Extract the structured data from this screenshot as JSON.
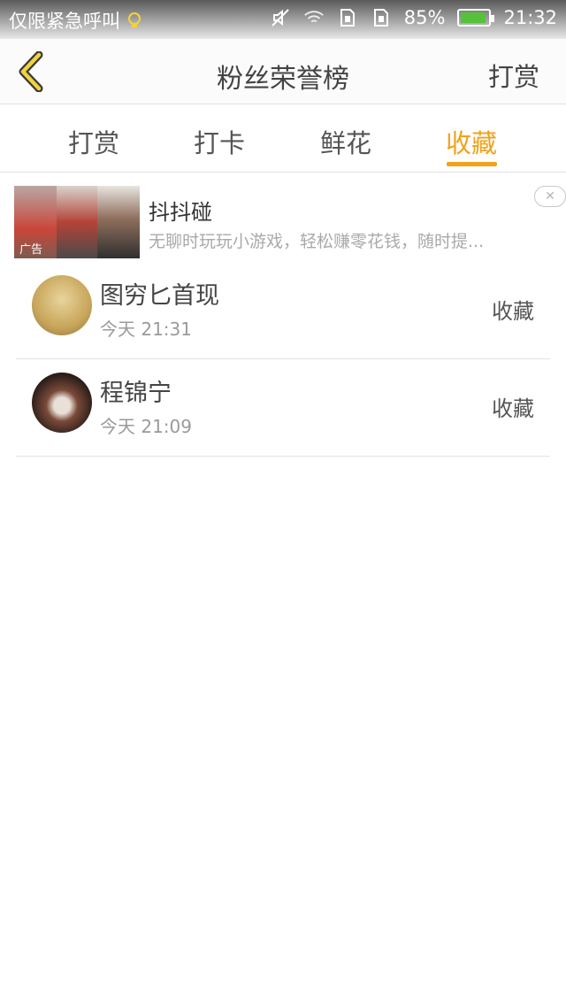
{
  "status_bar": {
    "notification_text": "仅限紧急呼叫",
    "battery_percent": "85%",
    "time": "21:32"
  },
  "header": {
    "title": "粉丝荣誉榜",
    "action_label": "打赏"
  },
  "tabs": [
    {
      "label": "打赏",
      "active": false
    },
    {
      "label": "打卡",
      "active": false
    },
    {
      "label": "鲜花",
      "active": false
    },
    {
      "label": "收藏",
      "active": true
    }
  ],
  "ad": {
    "title": "抖抖碰",
    "description": "无聊时玩玩小游戏，轻松赚零花钱，随时提...",
    "tag": "广告",
    "close_glyph": "✕"
  },
  "list": [
    {
      "name": "图穷匕首现",
      "time": "今天 21:31",
      "action": "收藏"
    },
    {
      "name": "程锦宁",
      "time": "今天 21:09",
      "action": "收藏"
    }
  ],
  "colors": {
    "accent": "#f0a21b",
    "back_icon": "#f2d33b"
  }
}
